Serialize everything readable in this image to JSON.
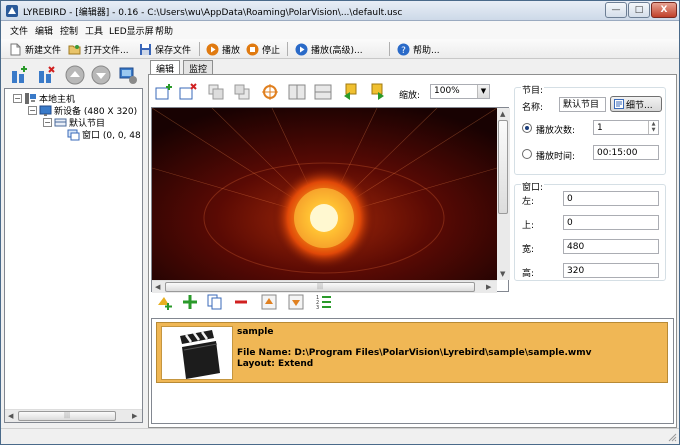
{
  "window": {
    "title": "LYREBIRD - [编辑器] - 0.16 - C:\\Users\\wu\\AppData\\Roaming\\PolarVision\\...\\default.usc",
    "minimize_glyph": "—",
    "maximize_glyph": "□",
    "close_glyph": "X"
  },
  "menu": {
    "items": [
      "文件",
      "编辑",
      "控制",
      "工具",
      "LED显示屏",
      "帮助"
    ]
  },
  "toolbar": {
    "new_file": "新建文件",
    "open_file": "打开文件...",
    "save_file": "保存文件",
    "play": "播放",
    "stop": "停止",
    "play_advanced": "播放(高级)...",
    "help": "帮助..."
  },
  "tree": {
    "host": "本地主机",
    "device": "新设备 (480 X 320)",
    "program": "默认节目",
    "window": "窗口 (0, 0, 48",
    "expand_glyph": "−"
  },
  "tabs": [
    "编辑",
    "监控"
  ],
  "editor": {
    "zoom_label": "缩放:",
    "zoom_value": "100%"
  },
  "program_panel": {
    "legend": "节目:",
    "name_label": "名称:",
    "name_value": "默认节目",
    "details_button": "细节...",
    "play_count_label": "播放次数:",
    "play_count_value": "1",
    "play_time_label": "播放时间:",
    "play_time_value": "00:15:00",
    "play_count_selected": true
  },
  "window_panel": {
    "legend": "窗口:",
    "left_label": "左:",
    "left_value": "0",
    "top_label": "上:",
    "top_value": "0",
    "width_label": "宽:",
    "width_value": "480",
    "height_label": "高:",
    "height_value": "320"
  },
  "playlist": {
    "items": [
      {
        "name": "sample",
        "file_line": "File Name: D:\\Program Files\\PolarVision\\Lyrebird\\sample\\sample.wmv",
        "layout_line": "Layout: Extend"
      }
    ]
  },
  "scroll": {
    "left_arrow": "◀",
    "right_arrow": "▶",
    "up_arrow": "▲",
    "down_arrow": "▼",
    "grip": "|||"
  },
  "colors": {
    "title_bar": "#cdd9e8",
    "selected_item_bg": "#f0b755",
    "close_button": "#c0402a"
  }
}
